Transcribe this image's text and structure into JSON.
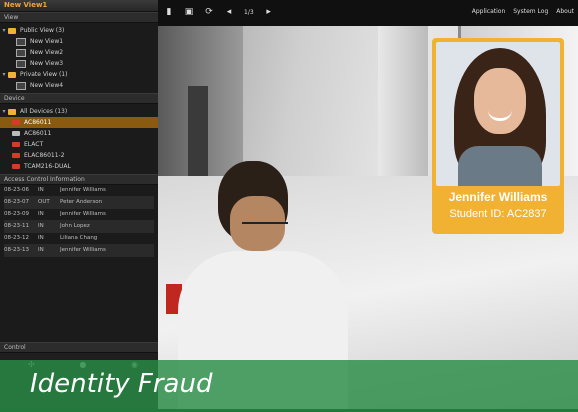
{
  "app": {
    "panel_title": "New View1",
    "view_section": "View"
  },
  "view_tree": [
    {
      "label": "Public View (3)",
      "type": "folder",
      "expanded": true
    },
    {
      "label": "New View1",
      "type": "view"
    },
    {
      "label": "New View2",
      "type": "view"
    },
    {
      "label": "New View3",
      "type": "view"
    },
    {
      "label": "Private View (1)",
      "type": "folder",
      "expanded": true
    },
    {
      "label": "New View4",
      "type": "view"
    }
  ],
  "device_section": "Device",
  "device_tree": [
    {
      "label": "All Devices (13)",
      "type": "folder"
    },
    {
      "label": "AC86011",
      "type": "camera",
      "selected": true
    },
    {
      "label": "AC86011",
      "type": "camera"
    },
    {
      "label": "ELACT",
      "type": "camera"
    },
    {
      "label": "ELAC86011-2",
      "type": "camera"
    },
    {
      "label": "TCAM216-DUAL",
      "type": "camera"
    }
  ],
  "access_section": "Access Control Information",
  "access_log": [
    {
      "time": "08-23-06",
      "code": "IN",
      "name": "Jennifer Williams"
    },
    {
      "time": "08-23-07",
      "code": "OUT",
      "name": "Peter Anderson"
    },
    {
      "time": "08-23-09",
      "code": "IN",
      "name": "Jennifer Williams"
    },
    {
      "time": "08-23-11",
      "code": "IN",
      "name": "John Lopez"
    },
    {
      "time": "08-23-12",
      "code": "IN",
      "name": "Liliana Chang"
    },
    {
      "time": "08-23-13",
      "code": "IN",
      "name": "Jennifer Williams"
    }
  ],
  "control_section": "Control",
  "toolbar": {
    "page_indicator": "1/3",
    "application": "Application",
    "system_log": "System Log",
    "about": "About"
  },
  "id_card": {
    "name": "Jennifer Williams",
    "student_id": "Student ID: AC2837",
    "border_color": "#f1b233"
  },
  "caption": {
    "text": "Identity Fraud",
    "bg_color": "#288c46"
  }
}
